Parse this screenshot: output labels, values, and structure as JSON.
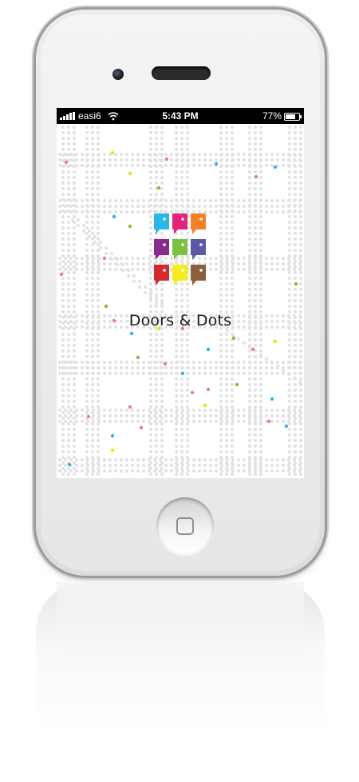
{
  "status_bar": {
    "carrier": "easi6",
    "time": "5:43 PM",
    "battery_percent": "77%",
    "battery_level": 0.77,
    "signal_icon": "signal-bars-icon",
    "wifi_icon": "wifi-icon",
    "battery_icon": "battery-icon"
  },
  "app": {
    "title": "Doors & Dots",
    "logo_icon": "doors-and-dots-logo-icon",
    "door_colors": [
      "#29b6e8",
      "#e6237c",
      "#f58220",
      "#8b2a8e",
      "#7cc242",
      "#5b5aa7",
      "#d7282f",
      "#f7ec1b",
      "#8b5e3c"
    ]
  },
  "device": {
    "home_button_icon": "home-button-icon",
    "body_color": "#e8e8e8"
  },
  "background": {
    "dot_color": "#e2e2e2",
    "accent_colors": [
      "#29b6e8",
      "#e57aa8",
      "#7cc242",
      "#f2e400"
    ]
  }
}
